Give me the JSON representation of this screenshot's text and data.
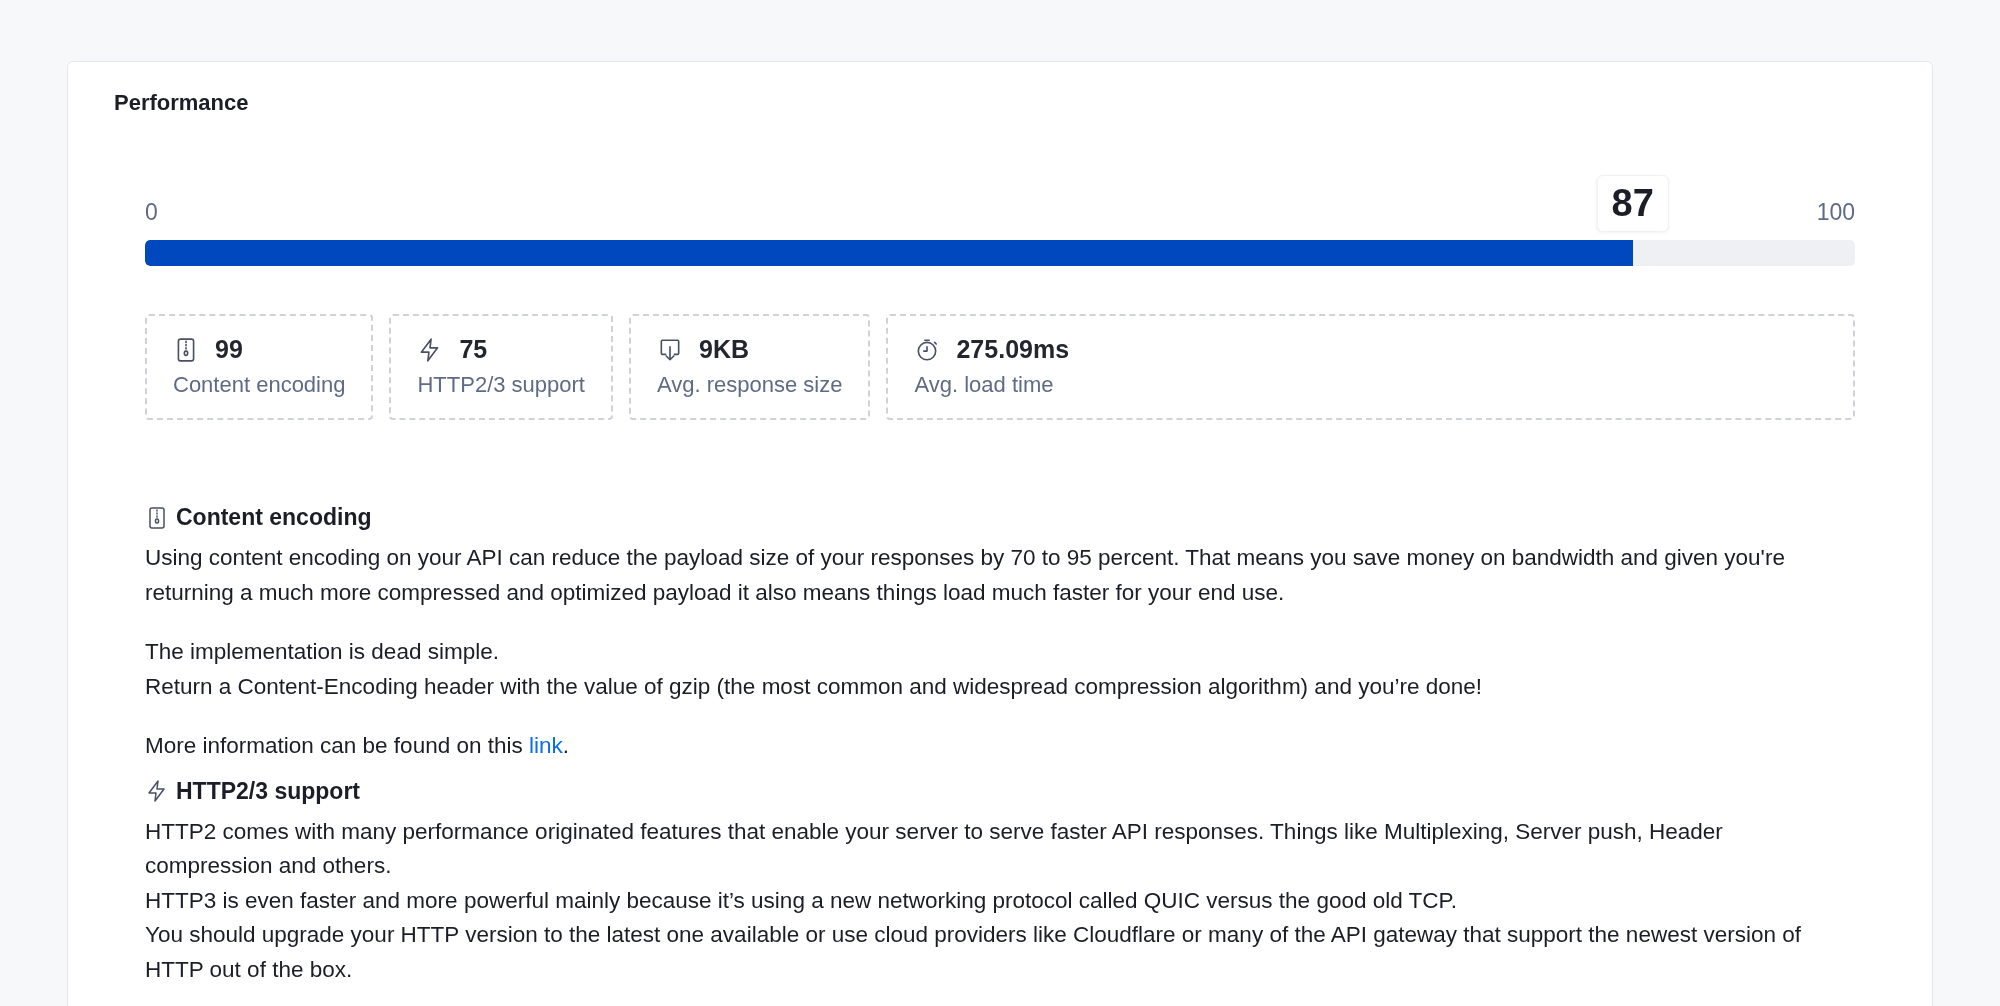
{
  "panel": {
    "title": "Performance"
  },
  "score": {
    "min": "0",
    "max": "100",
    "value": "87",
    "level": 0.87
  },
  "stats": [
    {
      "kind": "zip",
      "value": "99",
      "label": "Content encoding"
    },
    {
      "kind": "bolt",
      "value": "75",
      "label": "HTTP2/3 support"
    },
    {
      "kind": "download",
      "value": "9KB",
      "label": "Avg. response size"
    },
    {
      "kind": "timer",
      "value": "275.09ms",
      "label": "Avg. load time"
    }
  ],
  "sections": [
    {
      "kind": "zip",
      "heading": "Content encoding",
      "paragraphs": [
        {
          "lines": [
            "Using content encoding on your API can reduce the payload size of your responses by 70 to 95 percent. That means you save money on bandwidth and given you're returning a much more compressed and optimized payload it also means things load much faster for your end use."
          ]
        },
        {
          "lines": [
            "The implementation is dead simple.",
            "Return a Content-Encoding header with the value of gzip (the most common and widespread compression algorithm) and you’re done!"
          ]
        },
        {
          "lines": [
            "More information can be found on this "
          ],
          "link": "link",
          "after": "."
        }
      ]
    },
    {
      "kind": "bolt",
      "heading": "HTTP2/3 support",
      "paragraphs": [
        {
          "lines": [
            "HTTP2 comes with many performance originated features that enable your server to serve faster API responses. Things like Multiplexing, Server push, Header compression and others.",
            "HTTP3 is even faster and more powerful mainly because it’s using a new networking protocol called QUIC versus the good old TCP.",
            "You should upgrade your HTTP version to the latest one available or use cloud providers like Cloudflare or many of the API gateway that support the newest version of HTTP out of the box."
          ]
        }
      ]
    }
  ]
}
